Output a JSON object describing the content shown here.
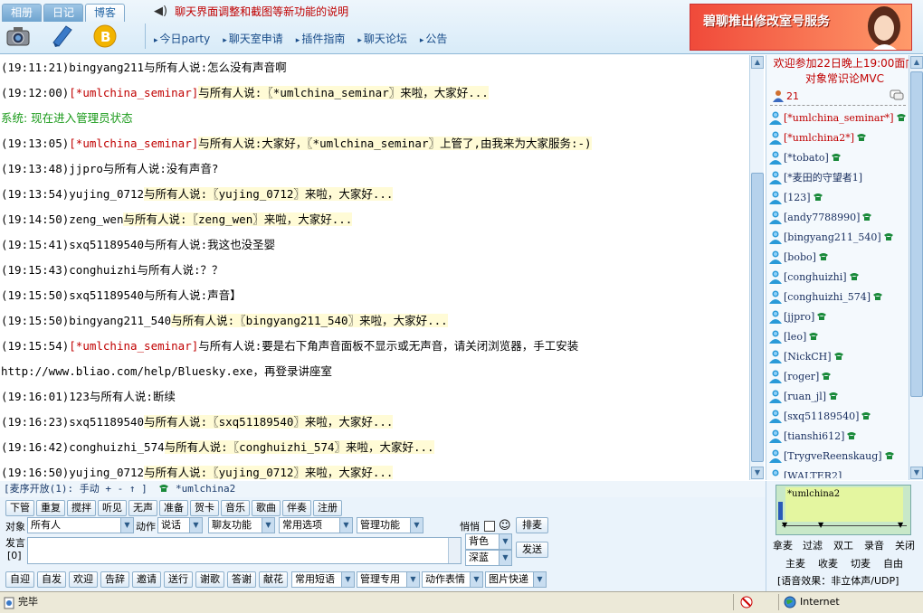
{
  "tabs": [
    "相册",
    "日记",
    "博客"
  ],
  "tab_icons": [
    "camera-icon",
    "notebook-icon",
    "blog-icon"
  ],
  "notice": "聊天界面调整和截图等新功能的说明",
  "nav": [
    "今日party",
    "聊天室申请",
    "插件指南",
    "聊天论坛",
    "公告"
  ],
  "ad": {
    "text": "碧聊推出修改室号服务"
  },
  "chat": [
    {
      "t": "(19:11:21)",
      "u": "bingyang211",
      "op": false,
      "m": "与所有人说:怎么没有声音啊",
      "hl": false
    },
    {
      "t": "(19:12:00)",
      "u": "[*umlchina_seminar]",
      "op": true,
      "m": "与所有人说:〖*umlchina_seminar〗来啦，大家好...",
      "hl": true
    },
    {
      "sys": "系统:   现在进入管理员状态"
    },
    {
      "t": "(19:13:05)",
      "u": "[*umlchina_seminar]",
      "op": true,
      "m": "与所有人说:大家好，〖*umlchina_seminar〗上管了,由我来为大家服务:-)",
      "hl": true
    },
    {
      "t": "(19:13:48)",
      "u": "jjpro",
      "op": false,
      "m": "与所有人说:没有声音?",
      "hl": false
    },
    {
      "t": "(19:13:54)",
      "u": "yujing_0712",
      "op": false,
      "m": "与所有人说:〖yujing_0712〗来啦，大家好...",
      "hl": true
    },
    {
      "t": "(19:14:50)",
      "u": "zeng_wen",
      "op": false,
      "m": "与所有人说:〖zeng_wen〗来啦，大家好...",
      "hl": true
    },
    {
      "t": "(19:15:41)",
      "u": "sxq51189540",
      "op": false,
      "m": "与所有人说:我这也没圣婴",
      "hl": false
    },
    {
      "t": "(19:15:43)",
      "u": "conghuizhi",
      "op": false,
      "m": "与所有人说:？？",
      "hl": false
    },
    {
      "t": "(19:15:50)",
      "u": "sxq51189540",
      "op": false,
      "m": "与所有人说:声音】",
      "hl": false
    },
    {
      "t": "(19:15:50)",
      "u": "bingyang211_540",
      "op": false,
      "m": "与所有人说:〖bingyang211_540〗来啦，大家好...",
      "hl": true
    },
    {
      "t": "(19:15:54)",
      "u": "[*umlchina_seminar]",
      "op": true,
      "m": "与所有人说:要是右下角声音面板不显示或无声音，请关闭浏览器，手工安装",
      "hl": false
    },
    {
      "raw": "http://www.bliao.com/help/Bluesky.exe，再登录讲座室"
    },
    {
      "t": "(19:16:01)",
      "u": "123",
      "op": false,
      "m": "与所有人说:断续",
      "hl": false
    },
    {
      "t": "(19:16:23)",
      "u": "sxq51189540",
      "op": false,
      "m": "与所有人说:〖sxq51189540〗来啦，大家好...",
      "hl": true
    },
    {
      "t": "(19:16:42)",
      "u": "conghuizhi_574",
      "op": false,
      "m": "与所有人说:〖conghuizhi_574〗来啦，大家好...",
      "hl": true
    },
    {
      "t": "(19:16:50)",
      "u": "yujing_0712",
      "op": false,
      "m": "与所有人说:〖yujing_0712〗来啦，大家好...",
      "hl": true
    }
  ],
  "side": {
    "welcome1": "欢迎参加22日晚上19:00面向",
    "welcome2": "对象常识论MVC",
    "count": "21",
    "users": [
      {
        "n": "[*umlchina_seminar*]",
        "op": true
      },
      {
        "n": "[*umlchina2*]",
        "op": true
      },
      {
        "n": "[*tobato]",
        "op": false
      },
      {
        "n": "[*麦田的守望者1]",
        "op": false
      },
      {
        "n": "[123]",
        "op": false
      },
      {
        "n": "[andy7788990]",
        "op": false
      },
      {
        "n": "[bingyang211_540]",
        "op": false
      },
      {
        "n": "[bobo]",
        "op": false
      },
      {
        "n": "[conghuizhi]",
        "op": false
      },
      {
        "n": "[conghuizhi_574]",
        "op": false
      },
      {
        "n": "[jjpro]",
        "op": false
      },
      {
        "n": "[leo]",
        "op": false
      },
      {
        "n": "[NickCH]",
        "op": false
      },
      {
        "n": "[roger]",
        "op": false
      },
      {
        "n": "[ruan_jl]",
        "op": false
      },
      {
        "n": "[sxq51189540]",
        "op": false
      },
      {
        "n": "[tianshi612]",
        "op": false
      },
      {
        "n": "[TrygveReenskaug]",
        "op": false
      },
      {
        "n": "[WALTER2]",
        "op": false
      }
    ]
  },
  "mic_row": "[麦序开放(1): 手动 + - ↑ ]",
  "mic_user": "*umlchina2",
  "ctrl": {
    "row1": [
      "下管",
      "重复",
      "搅拌",
      "听见",
      "无声",
      "准备",
      "贺卡",
      "音乐",
      "歌曲",
      "伴奏",
      "注册"
    ],
    "target_label": "对象",
    "target_value": "所有人",
    "action_label": "动作",
    "action_value": "说话",
    "feature1": "聊友功能",
    "feature2": "常用选项",
    "feature3": "管理功能",
    "whisper_label": "悄悄",
    "smile": "☺",
    "btn_sort": "排麦",
    "speak_label": "发言",
    "speak_count": "[0]",
    "bg_color": "背色",
    "deep_blue": "深蓝",
    "send": "发送",
    "row3": [
      "自迎",
      "自发",
      "欢迎",
      "告辞",
      "邀请",
      "送行",
      "谢歌",
      "答谢",
      "献花"
    ],
    "sel3": [
      "常用短语",
      "管理专用",
      "动作表情",
      "图片快递"
    ]
  },
  "mic_ctrl": {
    "row1": [
      "拿麦",
      "过滤",
      "双工",
      "录音",
      "关闭"
    ],
    "row2": [
      "主麦",
      "收麦",
      "切麦",
      "自由"
    ],
    "voice": "[语音效果：非立体声/UDP]"
  },
  "status": {
    "done": "完毕",
    "zone": "Internet"
  },
  "colors": {
    "accent": "#c00000",
    "system": "#1a9a1a",
    "link": "#1a4d8a"
  }
}
